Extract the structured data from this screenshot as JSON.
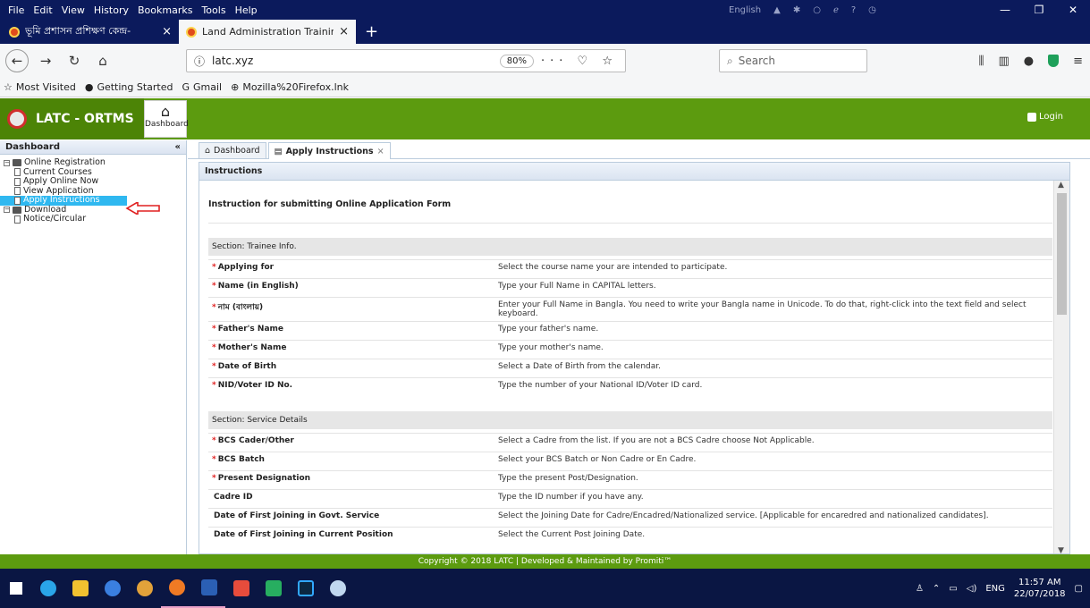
{
  "browser": {
    "menu": [
      "File",
      "Edit",
      "View",
      "History",
      "Bookmarks",
      "Tools",
      "Help"
    ],
    "tray_lang": "English",
    "win_controls": [
      "—",
      "❐",
      "✕"
    ],
    "tabs": [
      {
        "title": "ভূমি প্রশাসন প্রশিক্ষণ কেন্দ্র-",
        "close": "×"
      },
      {
        "title": "Land Administration Training C",
        "close": "×"
      }
    ],
    "new_tab": "+",
    "url": "latc.xyz",
    "zoom": "80%",
    "url_actions": "··· ♡ ☆",
    "search_placeholder": "Search",
    "bookmarks": [
      "Most Visited",
      "Getting Started",
      "Gmail",
      "Mozilla%20Firefox.lnk"
    ]
  },
  "app": {
    "brand": "LATC - ORTMS",
    "dashboard_button": "Dashboard",
    "login": "Login"
  },
  "sidebar": {
    "title": "Dashboard",
    "collapse": "«",
    "tree": [
      {
        "label": "Online Registration",
        "level": 0,
        "type": "folder"
      },
      {
        "label": "Current Courses",
        "level": 1,
        "type": "doc"
      },
      {
        "label": "Apply Online Now",
        "level": 1,
        "type": "doc"
      },
      {
        "label": "View Application",
        "level": 1,
        "type": "doc"
      },
      {
        "label": "Apply Instructions",
        "level": 1,
        "type": "doc",
        "selected": true
      },
      {
        "label": "Download",
        "level": 0,
        "type": "folder"
      },
      {
        "label": "Notice/Circular",
        "level": 1,
        "type": "doc"
      }
    ]
  },
  "content": {
    "tabs": [
      {
        "label": "Dashboard",
        "close": ""
      },
      {
        "label": "Apply Instructions",
        "close": "×"
      }
    ],
    "panel_title": "Instructions",
    "intro": "Instruction for submitting Online Application Form",
    "sections": [
      {
        "title": "Section: Trainee Info.",
        "rows": [
          {
            "req": "*",
            "field": "Applying for",
            "desc": "Select the course name your are intended to participate."
          },
          {
            "req": "*",
            "field": "Name (in English)",
            "desc": "Type your Full Name in CAPITAL letters."
          },
          {
            "req": "*",
            "field": "নাম (বাংলায়)",
            "desc": "Enter your Full Name in Bangla. You need to write your Bangla name in Unicode. To do that, right-click into the text field and select keyboard."
          },
          {
            "req": "*",
            "field": "Father's Name",
            "desc": "Type your father's name."
          },
          {
            "req": "*",
            "field": "Mother's Name",
            "desc": "Type your mother's name."
          },
          {
            "req": "*",
            "field": "Date of Birth",
            "desc": "Select a Date of Birth from the calendar."
          },
          {
            "req": "*",
            "field": "NID/Voter ID No.",
            "desc": "Type the number of your National ID/Voter ID card."
          }
        ]
      },
      {
        "title": "Section: Service Details",
        "rows": [
          {
            "req": "*",
            "field": "BCS Cader/Other",
            "desc": "Select a Cadre from the list. If you are not a BCS Cadre choose Not Applicable."
          },
          {
            "req": "*",
            "field": "BCS Batch",
            "desc": "Select your BCS Batch or Non Cadre or En Cadre."
          },
          {
            "req": "*",
            "field": "Present Designation",
            "desc": "Type the present Post/Designation."
          },
          {
            "req": "",
            "field": "Cadre ID",
            "desc": "Type the ID number if you have any."
          },
          {
            "req": "",
            "field": "Date of First Joining in Govt. Service",
            "desc": "Select the Joining Date for Cadre/Encadred/Nationalized service. [Applicable for encaredred and nationalized candidates]."
          },
          {
            "req": "",
            "field": "Date of First Joining in Current Position",
            "desc": "Select the Current Post Joining Date."
          }
        ]
      }
    ]
  },
  "footer": "Copyright © 2018 LATC | Developed & Maintained by Promiti™",
  "taskbar": {
    "lang": "ENG",
    "time": "11:57 AM",
    "date": "22/07/2018"
  }
}
